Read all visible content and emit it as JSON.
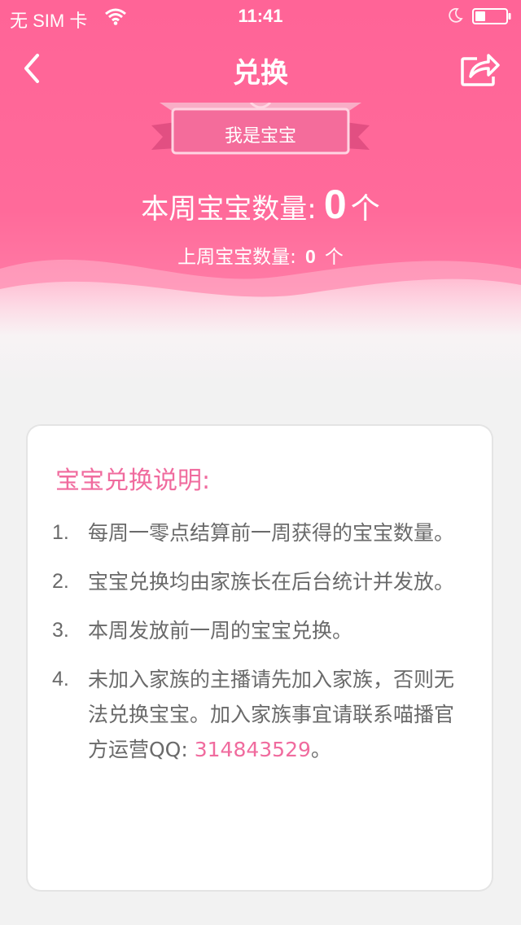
{
  "status_bar": {
    "carrier": "无 SIM 卡",
    "time": "11:41",
    "icons": [
      "wifi-icon",
      "moon-icon",
      "battery-icon"
    ]
  },
  "nav": {
    "title": "兑换",
    "back_icon": "chevron-left-icon",
    "share_icon": "share-icon"
  },
  "badge": {
    "label": "我是宝宝"
  },
  "counts": {
    "this_week_label": "本周宝宝数量:",
    "this_week_value": "0",
    "this_week_unit": "个",
    "last_week_label": "上周宝宝数量:",
    "last_week_value": "0",
    "last_week_unit": "个"
  },
  "card": {
    "title": "宝宝兑换说明:",
    "rules": [
      {
        "num": "1.",
        "text": "每周一零点结算前一周获得的宝宝数量。"
      },
      {
        "num": "2.",
        "text": "宝宝兑换均由家族长在后台统计并发放。"
      },
      {
        "num": "3.",
        "text": "本周发放前一周的宝宝兑换。"
      },
      {
        "num": "4.",
        "text": "未加入家族的主播请先加入家族，否则无法兑换宝宝。加入家族事宜请联系喵播官方运营QQ: ",
        "qq": "314843529",
        "tail": "。"
      }
    ]
  },
  "colors": {
    "primary_pink": "#ff6497",
    "accent_pink": "#f06b9e",
    "text_gray": "#6a6a6a",
    "background": "#f2f2f2"
  }
}
